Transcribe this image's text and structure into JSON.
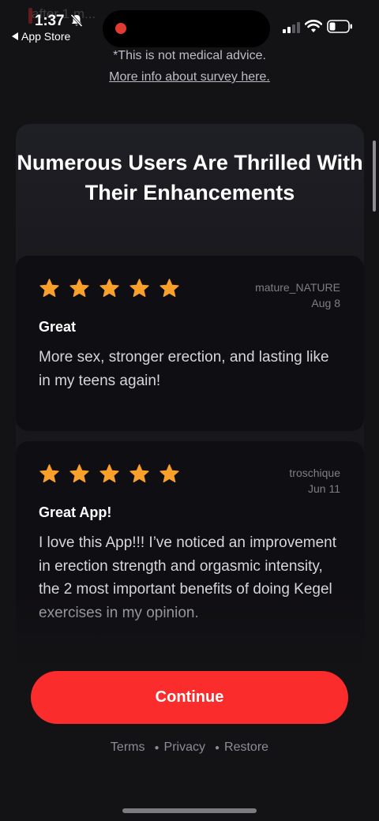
{
  "status_bar": {
    "time": "1:37",
    "back_app_label": "App Store",
    "ghost_text": "after 1 m..."
  },
  "header": {
    "disclaimer": "*This is not medical advice.",
    "survey_link": "More info about survey here."
  },
  "card": {
    "title": "Numerous Users Are Thrilled With Their Enhancements",
    "reviews": [
      {
        "rating": 5,
        "max_rating": 5,
        "author": "mature_NATURE",
        "date": "Aug 8",
        "title": "Great",
        "body": "More sex, stronger erection, and lasting like in my teens again!"
      },
      {
        "rating": 5,
        "max_rating": 5,
        "author": "troschique",
        "date": "Jun 11",
        "title": "Great App!",
        "body": "I love this App!!! I’ve noticed an improvement in erection strength and orgasmic intensity, the 2 most important benefits of doing Kegel exercises in my opinion."
      }
    ]
  },
  "actions": {
    "continue_label": "Continue"
  },
  "footer": {
    "links": [
      "Terms",
      "Privacy",
      "Restore"
    ]
  },
  "colors": {
    "background": "#131215",
    "accent": "#fb2c2c",
    "star": "#f8a02a",
    "record_dot": "#e23a31"
  }
}
